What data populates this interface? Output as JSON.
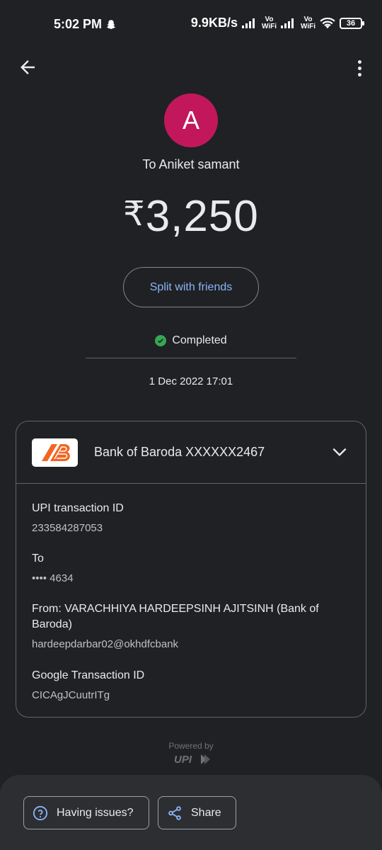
{
  "status_bar": {
    "time": "5:02 PM",
    "speed": "9.9KB/s",
    "vo_top": "Vo",
    "vo_bottom": "WiFi",
    "battery": "36"
  },
  "payment": {
    "avatar_letter": "A",
    "to_label": "To Aniket samant",
    "currency": "₹",
    "amount": "3,250",
    "split_button": "Split with friends",
    "status": "Completed",
    "datetime": "1 Dec 2022 17:01"
  },
  "card": {
    "bank_name": "Bank of Baroda XXXXXX2467",
    "upi_id_label": "UPI transaction ID",
    "upi_id_value": "233584287053",
    "to_label": "To",
    "to_value": "•••• 4634",
    "from_label": "From: VARACHHIYA HARDEEPSINH AJITSINH (Bank of Baroda)",
    "from_value": "hardeepdarbar02@okhdfcbank",
    "google_id_label": "Google Transaction ID",
    "google_id_value": "CICAgJCuutrITg"
  },
  "footer": {
    "powered_by": "Powered by",
    "upi_logo_text": "UPI"
  },
  "actions": {
    "issues_label": "Having issues?",
    "share_label": "Share"
  },
  "colors": {
    "background": "#202124",
    "avatar": "#c2185b",
    "accent": "#8ab4f8",
    "success": "#34a853",
    "bank_orange": "#f26522"
  },
  "icons": [
    "back-arrow-icon",
    "more-vert-icon",
    "check-circle-icon",
    "chevron-down-icon",
    "help-circle-icon",
    "share-icon",
    "snapchat-icon",
    "wifi-icon",
    "signal-icon"
  ]
}
